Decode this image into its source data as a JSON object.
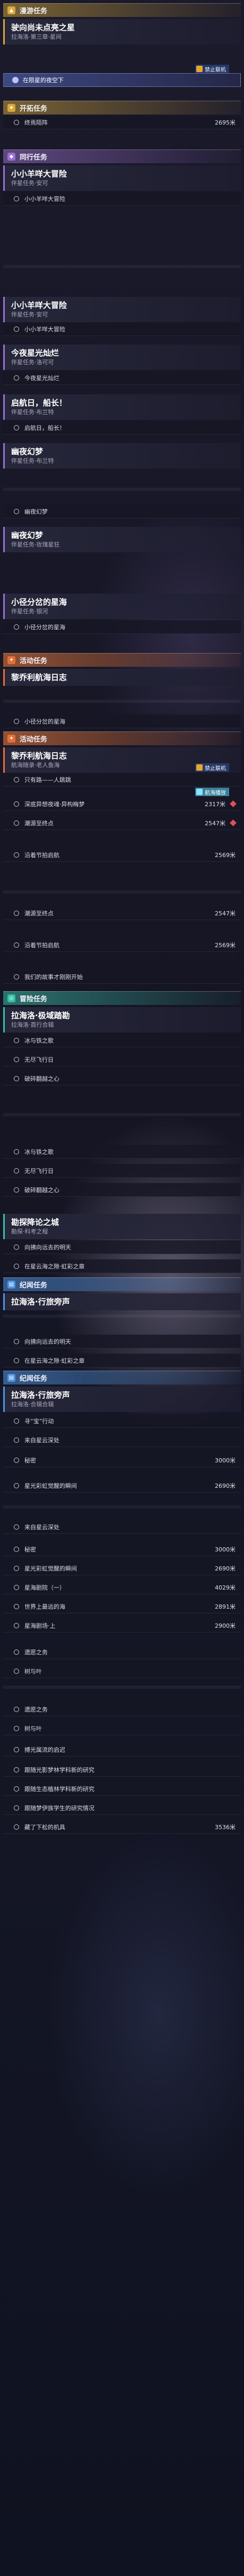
{
  "categories": {
    "travel": "漫游任务",
    "trailblaze": "开拓任务",
    "companion": "同行任务",
    "event": "活动任务",
    "daily": "冒险任务",
    "side": "纪闻任务"
  },
  "missions": {
    "m1": {
      "title": "驶向尚未点亮之星",
      "sub": "拉海洛·第三章·星间"
    },
    "m2": {
      "title": "小小羊咩大冒险",
      "sub": "伴星任务·安可"
    },
    "m3": {
      "title": "小小羊咩大冒险",
      "sub": "伴星任务·安可"
    },
    "m4": {
      "title": "今夜星光灿烂",
      "sub": "伴星任务·洛可可"
    },
    "m5": {
      "title": "启航日，船长！",
      "sub": "伴星任务·布兰特"
    },
    "m6": {
      "title": "幽夜幻梦",
      "sub": "伴星任务·布兰特"
    },
    "m7": {
      "title": "幽夜幻梦",
      "sub": "伴星任务·玫瑰星狂"
    },
    "m8": {
      "title": "小径分岔的星海",
      "sub": "伴星任务·银河"
    },
    "m9": {
      "title": "黎乔利航海日志",
      "sub": ""
    },
    "m10": {
      "title": "黎乔利航海日志",
      "sub": "航海随录·老人鱼海"
    },
    "m11": {
      "title": "拉海洛·极域踏勘",
      "sub": "拉海洛·首行合辑"
    },
    "m12": {
      "title": "勘探降论之城",
      "sub": "勘探·科考之程"
    },
    "m13": {
      "title": "拉海洛·行旅旁声",
      "sub": ""
    },
    "m14": {
      "title": "拉海洛·行旅旁声",
      "sub": "拉海洛·合辑合辑"
    }
  },
  "rows": {
    "r1": {
      "label": "在陨星的夜空下"
    },
    "r2": {
      "label": "终焉陌阵",
      "dist": "2695米"
    },
    "r3": {
      "label": "小小羊咩大冒险"
    },
    "r4": {
      "label": "小小羊咩大冒险"
    },
    "r5": {
      "label": "今夜星光灿烂"
    },
    "r6": {
      "label": "启航日，船长！"
    },
    "r7": {
      "label": "幽夜幻梦"
    },
    "r8": {
      "label": "小径分岔的星海"
    },
    "r9": {
      "label": "小径分岔的星海"
    },
    "r10": {
      "label": "只有路——人跳跳"
    },
    "r11": {
      "label": "深底异想夜魂·异构梅梦",
      "dist": "2317米"
    },
    "r12": {
      "label": "潮源至终点",
      "dist": "2547米"
    },
    "r13": {
      "label": "沿着节拍启航",
      "dist": "2569米"
    },
    "r14": {
      "label": "潮源至终点",
      "dist": "2547米"
    },
    "r15": {
      "label": "沿着节拍启航",
      "dist": "2569米"
    },
    "r16": {
      "label": "我们的故事才刚刚开始"
    },
    "r17": {
      "label": "冰与铁之歌"
    },
    "r18": {
      "label": "无尽飞行日"
    },
    "r19": {
      "label": "破碎翻越之心"
    },
    "r20": {
      "label": "冰与铁之歌"
    },
    "r21": {
      "label": "无尽飞行日"
    },
    "r22": {
      "label": "破碎翻越之心"
    },
    "r23": {
      "label": "向拂向远去的明天"
    },
    "r24": {
      "label": "在星云海之隙·虹彩之章"
    },
    "r25": {
      "label": "向拂向远去的明天"
    },
    "r26": {
      "label": "在星云海之隙·虹彩之章"
    },
    "r27": {
      "label": "寻“宝”行动"
    },
    "r28": {
      "label": "来自星云深处"
    },
    "r29": {
      "label": "秘密",
      "dist": "3000米"
    },
    "r30": {
      "label": "星光彩虹觉醒的瞬间",
      "dist": "2690米"
    },
    "r31": {
      "label": "来自星云深处"
    },
    "r32": {
      "label": "秘密",
      "dist": "3000米"
    },
    "r33": {
      "label": "星光彩虹觉醒的瞬间",
      "dist": "2690米"
    },
    "r34": {
      "label": "星海剧院（一）",
      "dist": "4029米"
    },
    "r35": {
      "label": "世界上最远的海",
      "dist": "2891米"
    },
    "r36": {
      "label": "星海剧场·上",
      "dist": "2900米"
    },
    "r37": {
      "label": "遗愿之务"
    },
    "r38": {
      "label": "树与叶"
    },
    "r39": {
      "label": "遗愿之务"
    },
    "r40": {
      "label": "树与叶"
    },
    "r41": {
      "label": "搏光属流的启迟"
    },
    "r42": {
      "label": "跟随光影梦林学科新的研究"
    },
    "r43": {
      "label": "跟随生态植林学科新的研究"
    },
    "r44": {
      "label": "跟随梦伊族学生的研究情况"
    },
    "r45": {
      "label": "藏了下松的机具",
      "dist": "3536米"
    }
  },
  "tags": {
    "lock_label": "禁止联机",
    "nav_label": "航海播放",
    "x_mark": "✕"
  }
}
